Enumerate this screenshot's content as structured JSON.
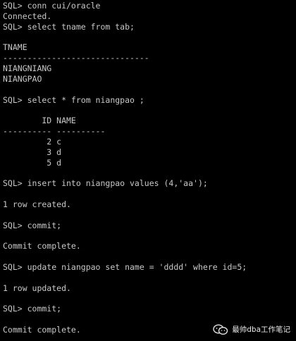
{
  "terminal": {
    "lines": [
      "SQL> conn cui/oracle",
      "Connected.",
      "SQL> select tname from tab;",
      "",
      "TNAME",
      "------------------------------",
      "NIANGNIANG",
      "NIANGPAO",
      "",
      "SQL> select * from niangpao ;",
      "",
      "        ID NAME",
      "---------- ----------",
      "         2 c",
      "         3 d",
      "         5 d",
      "",
      "SQL> insert into niangpao values (4,'aa');",
      "",
      "1 row created.",
      "",
      "SQL> commit;",
      "",
      "Commit complete.",
      "",
      "SQL> update niangpao set name = 'dddd' where id=5;",
      "",
      "1 row updated.",
      "",
      "SQL> commit;",
      "",
      "Commit complete."
    ]
  },
  "watermark": {
    "text": "最帅dba工作笔记",
    "icon": "wechat-icon"
  },
  "colors": {
    "background": "#000000",
    "text": "#c8c8c8"
  }
}
